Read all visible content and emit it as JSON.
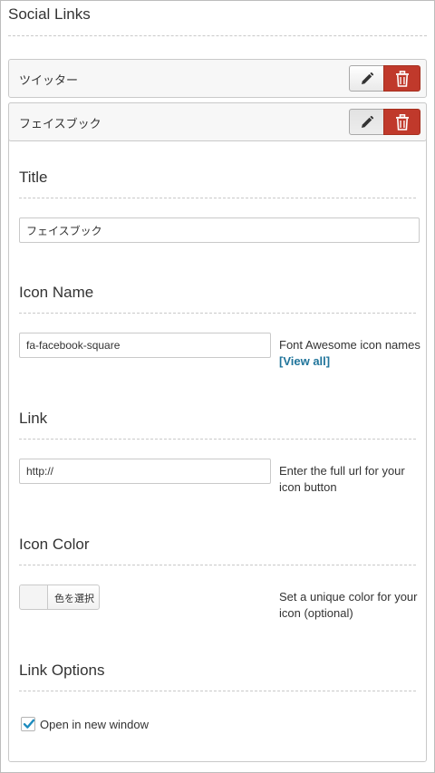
{
  "widget": {
    "heading": "Social Links"
  },
  "items": [
    {
      "label": "ツイッター"
    },
    {
      "label": "フェイスブック"
    }
  ],
  "form": {
    "title": {
      "label": "Title",
      "value": "フェイスブック"
    },
    "icon_name": {
      "label": "Icon Name",
      "value": "fa-facebook-square",
      "help_text": "Font Awesome icon names",
      "help_link": "[View all]"
    },
    "link": {
      "label": "Link",
      "value": "http://",
      "help_text": "Enter the full url for your icon button"
    },
    "icon_color": {
      "label": "Icon Color",
      "button_label": "色を選択",
      "help_text": "Set a unique color for your icon (optional)"
    },
    "link_options": {
      "label": "Link Options",
      "checkbox_label": "Open in new window",
      "checked": true
    }
  },
  "colors": {
    "delete": "#c0392b",
    "link": "#21759b",
    "checkmark": "#1e8cbe"
  }
}
